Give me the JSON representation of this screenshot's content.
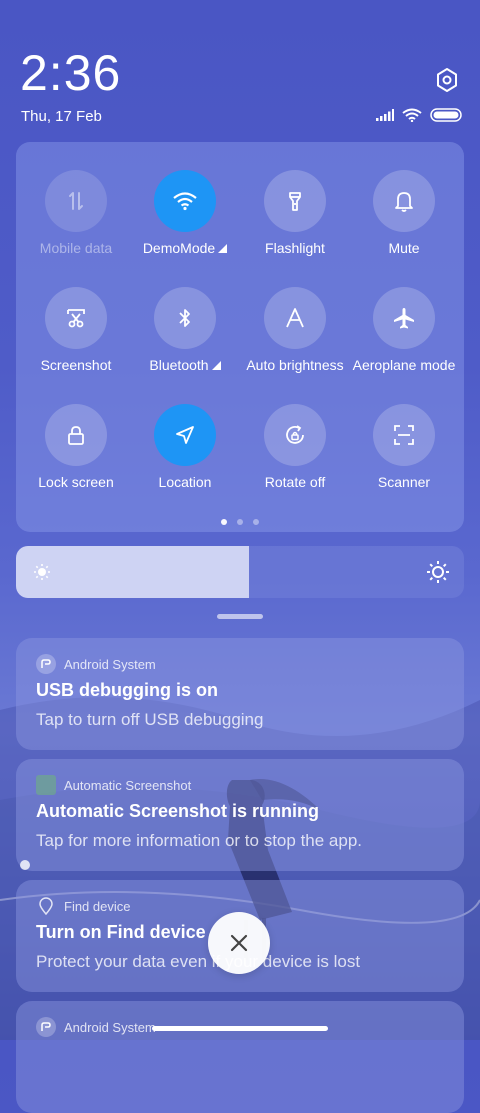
{
  "status_bar": {
    "time": "2:36",
    "date": "Thu, 17 Feb",
    "icons": [
      "signal-icon",
      "wifi-icon",
      "battery-icon"
    ]
  },
  "settings_icon": "gear-icon",
  "quick_settings": {
    "tiles": [
      {
        "label": "Mobile data",
        "icon": "mobile-data-icon",
        "state": "disabled"
      },
      {
        "label": "DemoMode",
        "icon": "wifi-icon",
        "state": "active",
        "has_more": true
      },
      {
        "label": "Flashlight",
        "icon": "flashlight-icon",
        "state": "off"
      },
      {
        "label": "Mute",
        "icon": "bell-icon",
        "state": "off"
      },
      {
        "label": "Screenshot",
        "icon": "scissors-icon",
        "state": "off"
      },
      {
        "label": "Bluetooth",
        "icon": "bluetooth-icon",
        "state": "off",
        "has_more": true
      },
      {
        "label": "Auto brightness",
        "icon": "auto-brightness-icon",
        "state": "off"
      },
      {
        "label": "Aeroplane mode",
        "icon": "airplane-icon",
        "state": "off"
      },
      {
        "label": "Lock screen",
        "icon": "lock-icon",
        "state": "off"
      },
      {
        "label": "Location",
        "icon": "location-arrow-icon",
        "state": "active"
      },
      {
        "label": "Rotate off",
        "icon": "rotate-lock-icon",
        "state": "off"
      },
      {
        "label": "Scanner",
        "icon": "scanner-icon",
        "state": "off"
      }
    ],
    "page_count": 3,
    "current_page": 1
  },
  "brightness": {
    "level": 0.52
  },
  "notifications": [
    {
      "app": "Android System",
      "title": "USB debugging is on",
      "text": "Tap to turn off USB debugging"
    },
    {
      "app": "Automatic Screenshot",
      "title": "Automatic Screenshot is running",
      "text": "Tap for more information or to stop the app."
    },
    {
      "app": "Find device",
      "title": "Turn on Find device",
      "text": "Protect your data even if your device is lost"
    },
    {
      "app": "Android System",
      "title": "",
      "text": ""
    }
  ],
  "accent_color": "#1e95f5"
}
